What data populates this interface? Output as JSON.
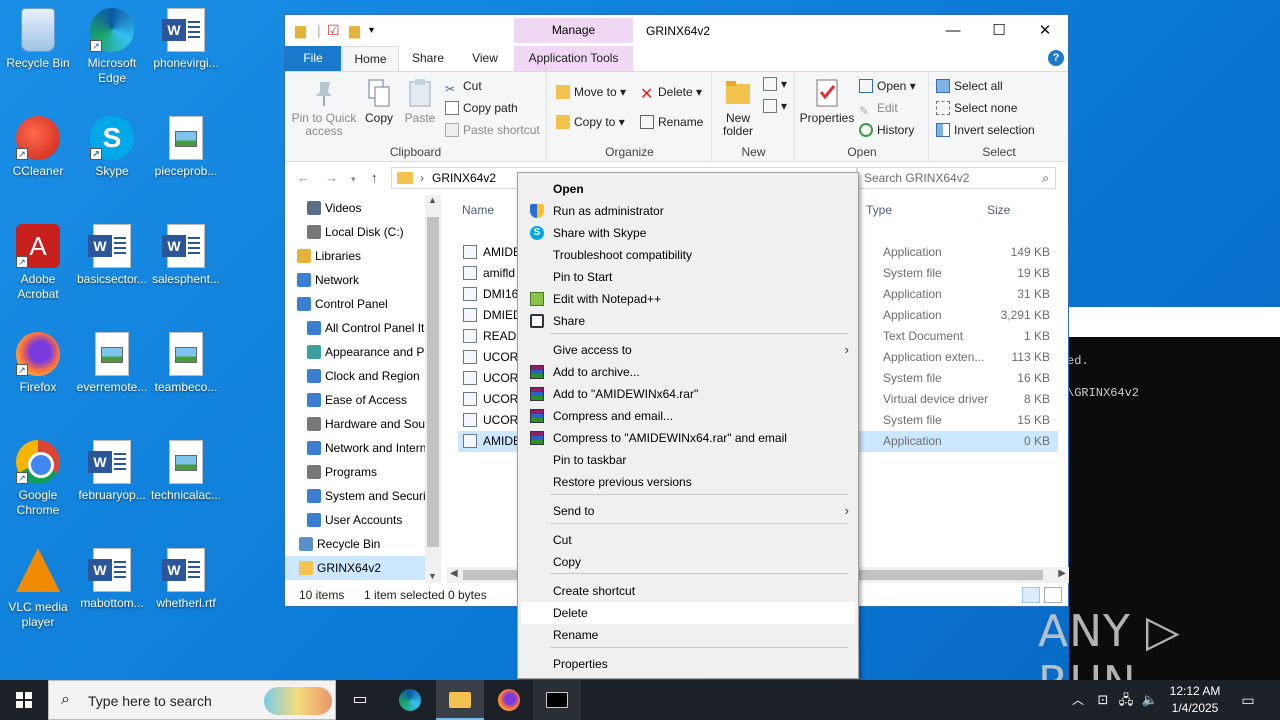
{
  "desktop": {
    "icons": [
      {
        "label": "Recycle Bin"
      },
      {
        "label": "Microsoft Edge"
      },
      {
        "label": "phonevirgi..."
      },
      {
        "label": "CCleaner"
      },
      {
        "label": "Skype"
      },
      {
        "label": "pieceprob..."
      },
      {
        "label": "Adobe Acrobat"
      },
      {
        "label": "basicsector..."
      },
      {
        "label": "salesphent..."
      },
      {
        "label": "Firefox"
      },
      {
        "label": "everremote..."
      },
      {
        "label": "teambeco..."
      },
      {
        "label": "Google Chrome"
      },
      {
        "label": "februaryop..."
      },
      {
        "label": "technicalac..."
      },
      {
        "label": "VLC media player"
      },
      {
        "label": "mabottom..."
      },
      {
        "label": "whetherl.rtf"
      }
    ]
  },
  "explorer": {
    "title": "GRINX64v2",
    "manage_tab": "Manage",
    "window_buttons": {
      "minimize": "—",
      "maximize": "☐",
      "close": "✕"
    },
    "tabs": {
      "file": "File",
      "home": "Home",
      "share": "Share",
      "view": "View",
      "app_tools": "Application Tools"
    },
    "help": "?",
    "ribbon": {
      "clipboard": {
        "label": "Clipboard",
        "pin": "Pin to Quick access",
        "copy": "Copy",
        "paste": "Paste",
        "cut": "Cut",
        "copy_path": "Copy path",
        "paste_shortcut": "Paste shortcut"
      },
      "organize": {
        "label": "Organize",
        "move_to": "Move to",
        "copy_to": "Copy to",
        "delete": "Delete",
        "rename": "Rename"
      },
      "new": {
        "label": "New",
        "new_folder": "New folder"
      },
      "open": {
        "label": "Open",
        "properties": "Properties",
        "open": "Open",
        "edit": "Edit",
        "history": "History"
      },
      "select": {
        "label": "Select",
        "select_all": "Select all",
        "select_none": "Select none",
        "invert": "Invert selection"
      }
    },
    "address": {
      "sep": "›",
      "path": "GRINX64v2",
      "search_placeholder": "Search GRINX64v2"
    },
    "nav": [
      {
        "label": "Videos"
      },
      {
        "label": "Local Disk (C:)"
      },
      {
        "label": "Libraries"
      },
      {
        "label": "Network"
      },
      {
        "label": "Control Panel"
      },
      {
        "label": "All Control Panel Items"
      },
      {
        "label": "Appearance and Personalization"
      },
      {
        "label": "Clock and Region"
      },
      {
        "label": "Ease of Access"
      },
      {
        "label": "Hardware and Sound"
      },
      {
        "label": "Network and Internet"
      },
      {
        "label": "Programs"
      },
      {
        "label": "System and Security"
      },
      {
        "label": "User Accounts"
      },
      {
        "label": "Recycle Bin"
      },
      {
        "label": "GRINX64v2"
      }
    ],
    "columns": {
      "name": "Name",
      "type": "Type",
      "size": "Size"
    },
    "files": [
      {
        "name": "AMIDE",
        "type": "Application",
        "size": "149 KB"
      },
      {
        "name": "amifld",
        "type": "System file",
        "size": "19 KB"
      },
      {
        "name": "DMI16",
        "type": "Application",
        "size": "31 KB"
      },
      {
        "name": "DMIED",
        "type": "Application",
        "size": "3,291 KB"
      },
      {
        "name": "READM",
        "type": "Text Document",
        "size": "1 KB"
      },
      {
        "name": "UCORE",
        "type": "Application exten...",
        "size": "113 KB"
      },
      {
        "name": "UCORE",
        "type": "System file",
        "size": "16 KB"
      },
      {
        "name": "UCORE",
        "type": "Virtual device driver",
        "size": "8 KB"
      },
      {
        "name": "UCORE",
        "type": "System file",
        "size": "15 KB"
      },
      {
        "name": "AMIDE",
        "type": "Application",
        "size": "0 KB"
      }
    ],
    "status": {
      "items": "10 items",
      "selected": "1 item selected",
      "bytes": "0 bytes"
    }
  },
  "context_menu": {
    "items": [
      {
        "label": "Open"
      },
      {
        "label": "Run as administrator"
      },
      {
        "label": "Share with Skype"
      },
      {
        "label": "Troubleshoot compatibility"
      },
      {
        "label": "Pin to Start"
      },
      {
        "label": "Edit with Notepad++"
      },
      {
        "label": "Share"
      },
      {
        "label": "Give access to"
      },
      {
        "label": "Add to archive..."
      },
      {
        "label": "Add to \"AMIDEWINx64.rar\""
      },
      {
        "label": "Compress and email..."
      },
      {
        "label": "Compress to \"AMIDEWINx64.rar\" and email"
      },
      {
        "label": "Pin to taskbar"
      },
      {
        "label": "Restore previous versions"
      },
      {
        "label": "Send to"
      },
      {
        "label": "Cut"
      },
      {
        "label": "Copy"
      },
      {
        "label": "Create shortcut"
      },
      {
        "label": "Delete"
      },
      {
        "label": "Rename"
      },
      {
        "label": "Properties"
      }
    ]
  },
  "console": {
    "line1": "ed.",
    "line2": "\\GRINX64v2"
  },
  "watermark": "ANY ▷ RUN",
  "taskbar": {
    "search_placeholder": "Type here to search",
    "time": "12:12 AM",
    "date": "1/4/2025"
  }
}
